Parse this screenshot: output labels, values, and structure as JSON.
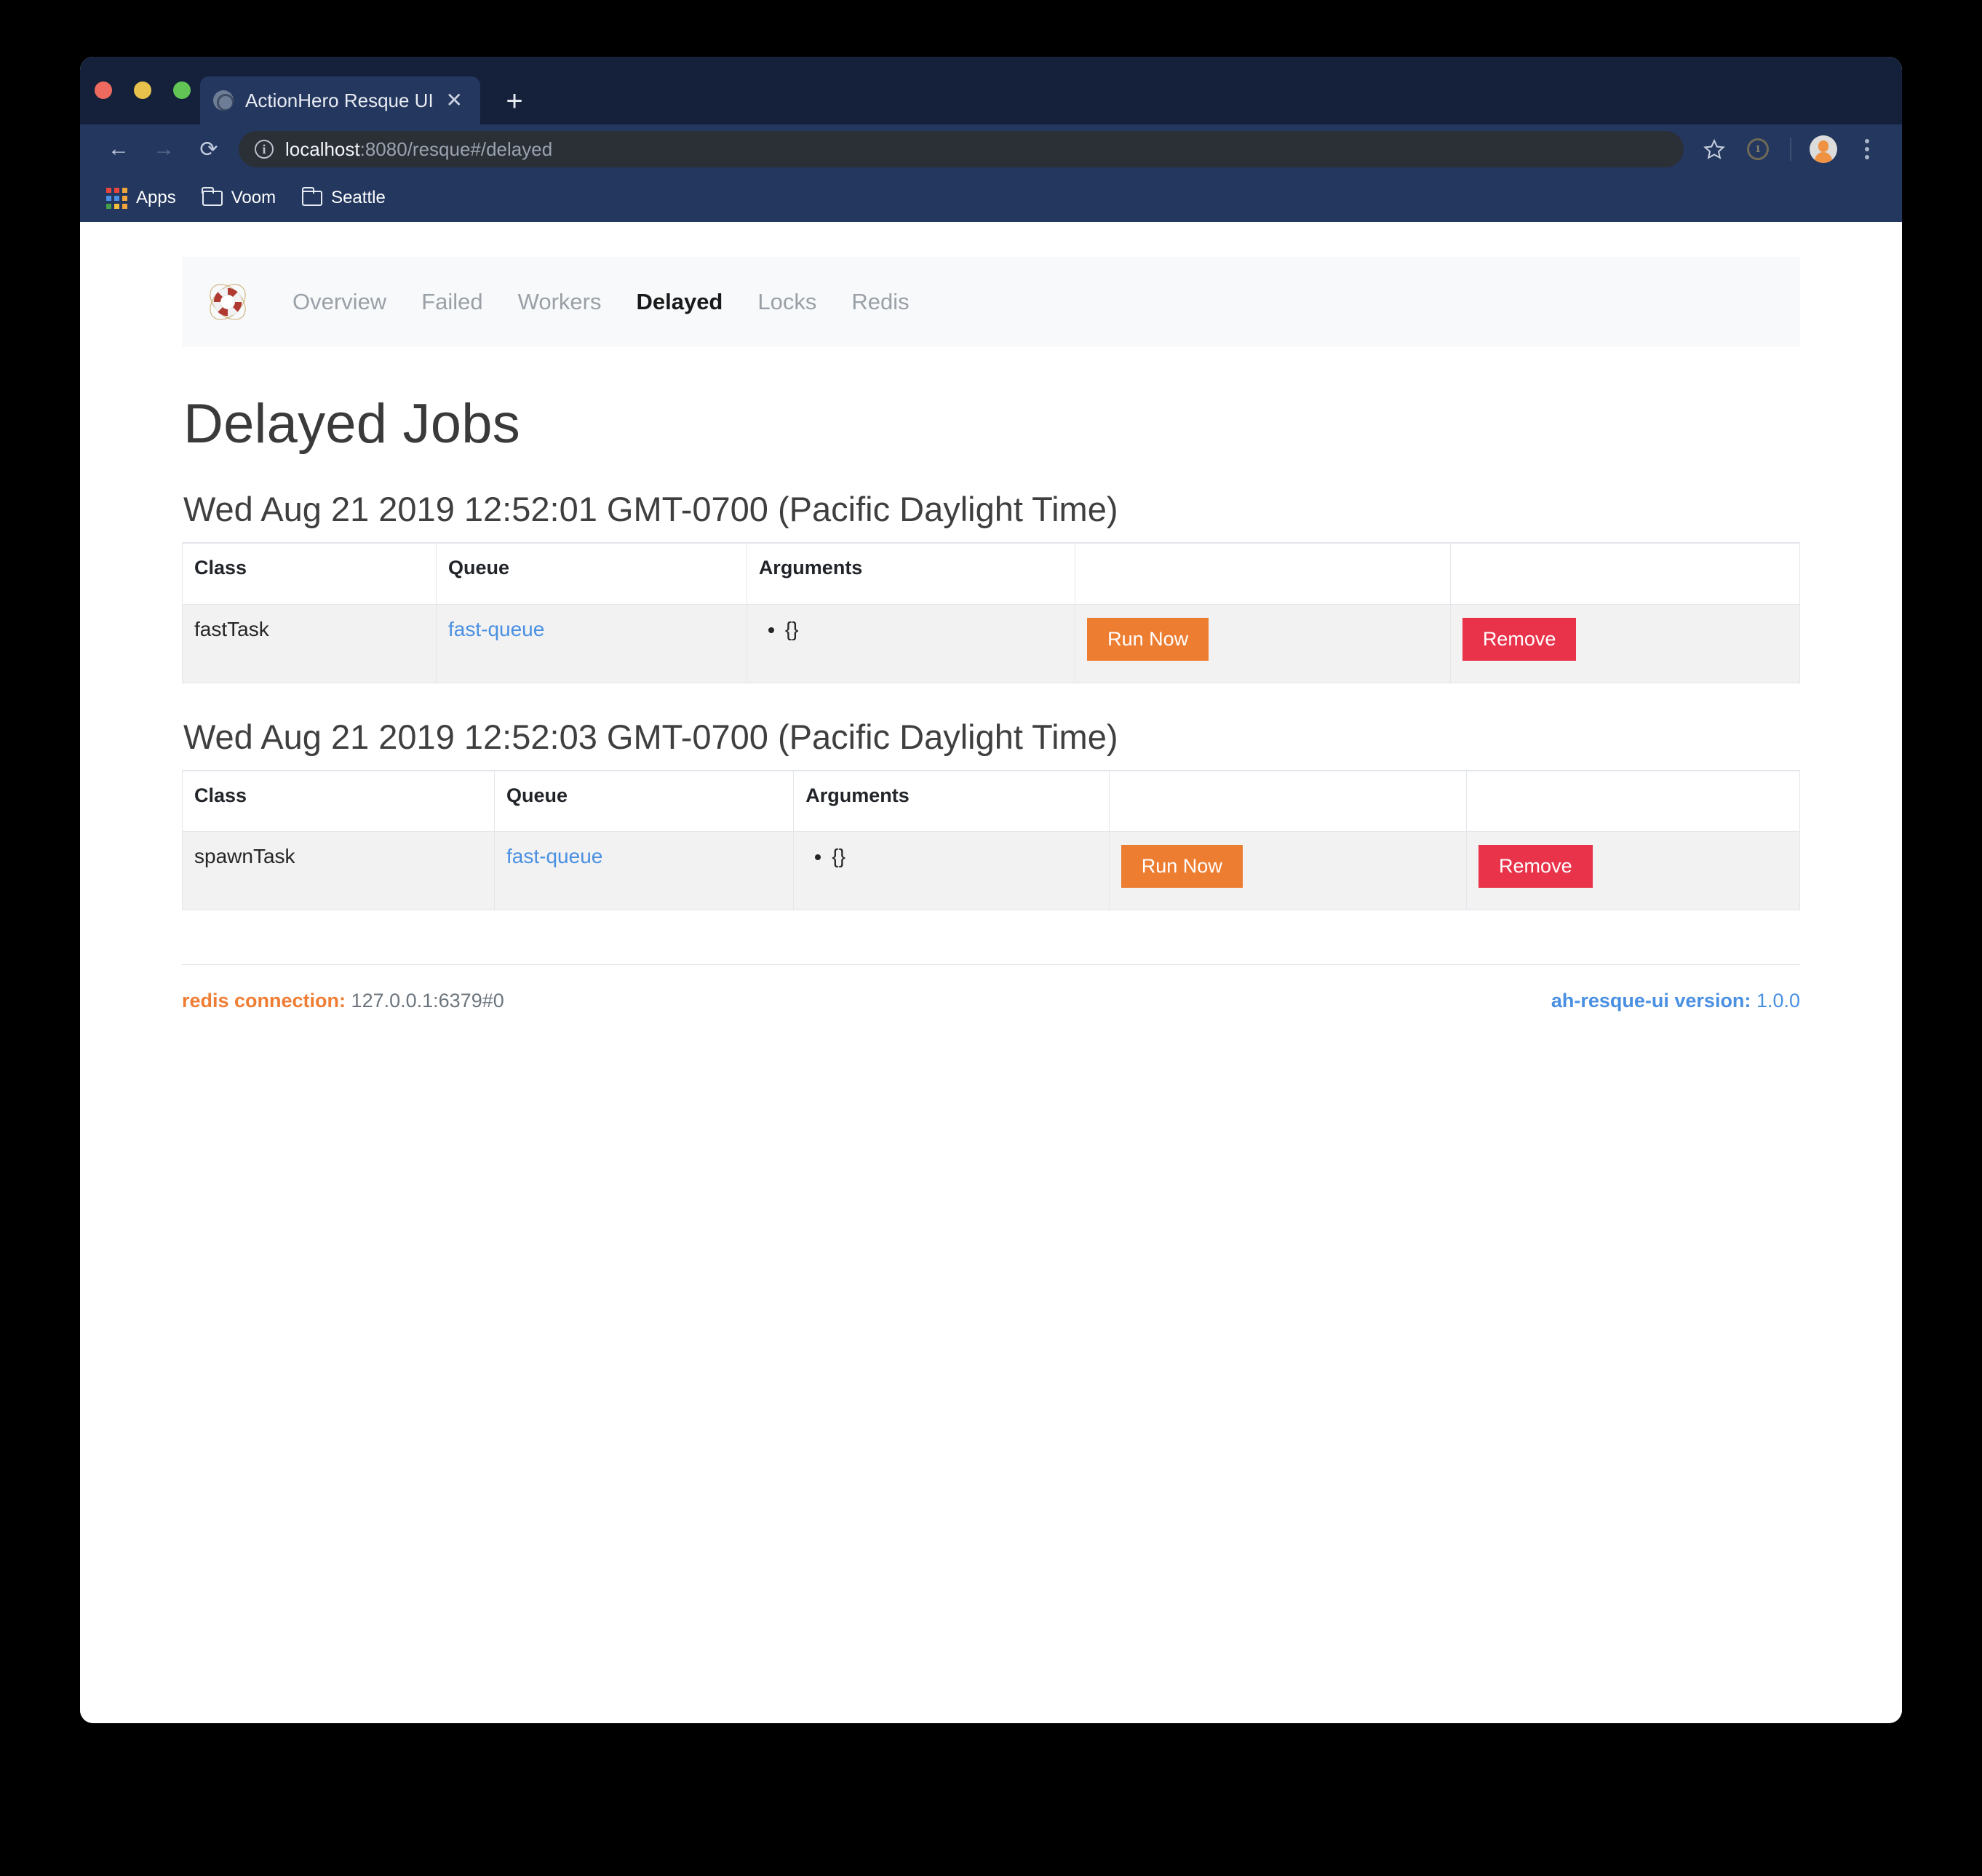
{
  "browser": {
    "traffic_lights": [
      {
        "name": "close",
        "color": "#ee6a5f"
      },
      {
        "name": "minimize",
        "color": "#e8c14c"
      },
      {
        "name": "zoom",
        "color": "#62c454"
      }
    ],
    "tab": {
      "title": "ActionHero Resque UI",
      "close_label": "✕",
      "favicon_name": "lifebuoy-favicon"
    },
    "new_tab_label": "+",
    "nav": {
      "back_label": "←",
      "forward_label": "→",
      "reload_label": "⟳"
    },
    "url": {
      "site_info_label": "i",
      "host": "localhost",
      "path": ":8080/resque#/delayed",
      "full": "localhost:8080/resque#/delayed"
    },
    "omnibox_icons": [
      "star-icon",
      "1password-icon",
      "profile-avatar",
      "menu-dots-icon"
    ],
    "bookmarks": [
      {
        "label": "Apps",
        "icon": "apps-grid-icon"
      },
      {
        "label": "Voom",
        "icon": "folder-icon"
      },
      {
        "label": "Seattle",
        "icon": "folder-icon"
      }
    ]
  },
  "app": {
    "logo_name": "lifebuoy-logo",
    "nav_links": [
      {
        "label": "Overview",
        "active": false
      },
      {
        "label": "Failed",
        "active": false
      },
      {
        "label": "Workers",
        "active": false
      },
      {
        "label": "Delayed",
        "active": true
      },
      {
        "label": "Locks",
        "active": false
      },
      {
        "label": "Redis",
        "active": false
      }
    ],
    "page_title": "Delayed Jobs",
    "columns": [
      "Class",
      "Queue",
      "Arguments",
      "",
      ""
    ],
    "groups": [
      {
        "heading": "Wed Aug 21 2019 12:52:01 GMT-0700 (Pacific Daylight Time)",
        "rows": [
          {
            "class": "fastTask",
            "queue": "fast-queue",
            "arguments": [
              "{}"
            ],
            "run_label": "Run Now",
            "remove_label": "Remove"
          }
        ]
      },
      {
        "heading": "Wed Aug 21 2019 12:52:03 GMT-0700 (Pacific Daylight Time)",
        "rows": [
          {
            "class": "spawnTask",
            "queue": "fast-queue",
            "arguments": [
              "{}"
            ],
            "run_label": "Run Now",
            "remove_label": "Remove"
          }
        ]
      }
    ],
    "footer": {
      "redis_label": "redis connection:",
      "redis_value": "127.0.0.1:6379#0",
      "version_label": "ah-resque-ui version:",
      "version_value": "1.0.0"
    },
    "colors": {
      "run_button": "#ed7d31",
      "remove_button": "#e8334a",
      "link": "#4a90e2",
      "navbar_bg": "#f7f9fb",
      "browser_chrome": "#24375f",
      "tabstrip_bg": "#15213b"
    }
  }
}
